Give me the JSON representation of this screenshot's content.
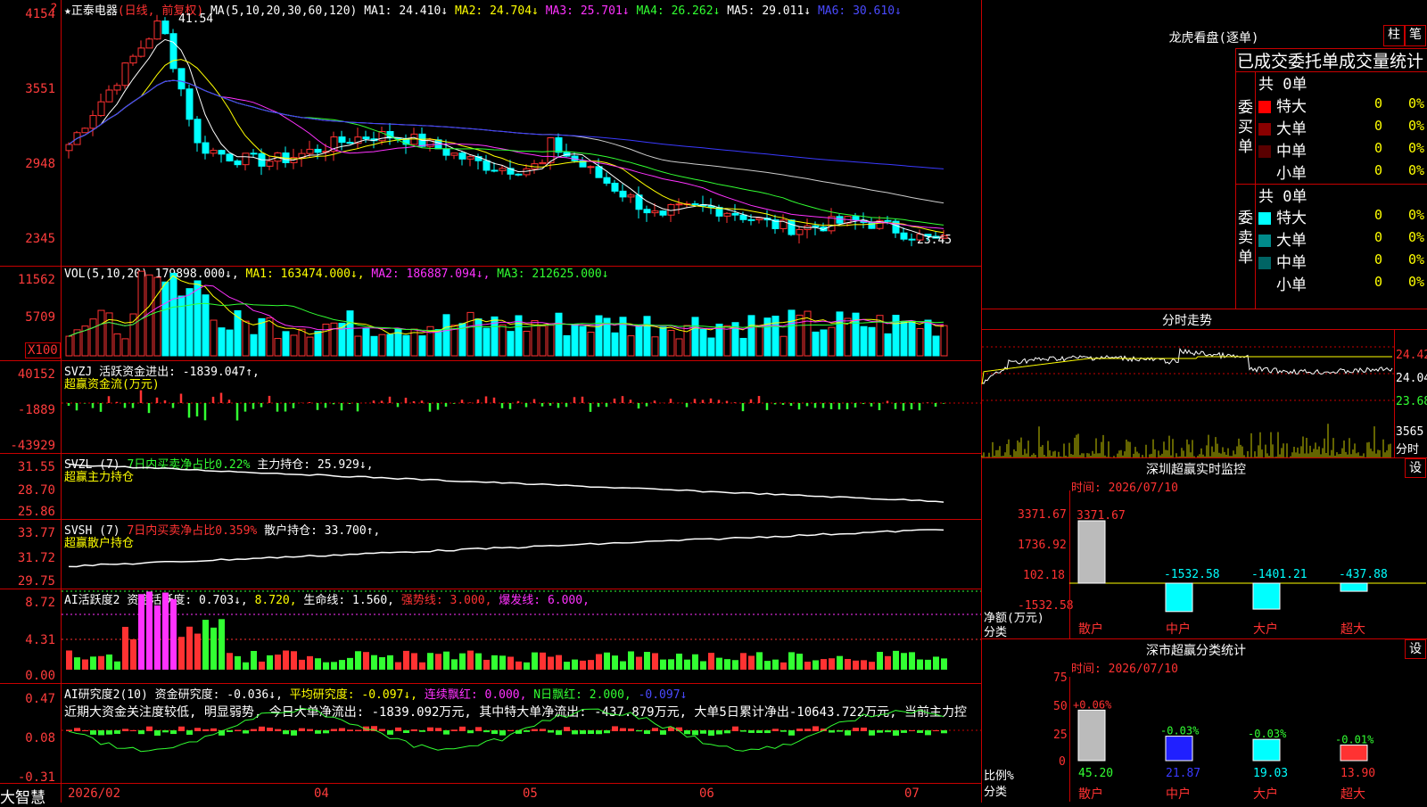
{
  "stock": {
    "name": "正泰电器",
    "period": "(日线, 前复权)",
    "high_label": "41.54",
    "low_label": "23.45"
  },
  "ma_line": {
    "label": "MA(5,10,20,30,60,120)",
    "ma1": "MA1: 24.410↓",
    "ma2": "MA2: 24.704↓",
    "ma3": "MA3: 25.701↓",
    "ma4": "MA4: 26.262↓",
    "ma5": "MA5: 29.011↓",
    "ma6": "MA6: 30.610↓"
  },
  "price_axis": [
    "4154",
    "3551",
    "2948",
    "2345"
  ],
  "vol": {
    "label": "VOL(5,10,20)",
    "value": "179898.000↓,",
    "ma1": "MA1: 163474.000↓,",
    "ma2": "MA2: 186887.094↓,",
    "ma3": "MA3: 212625.000↓",
    "axis": [
      "11562",
      "5709",
      "X100"
    ]
  },
  "svzj": {
    "label": "SVZJ",
    "text": "活跃资金进出: -1839.047↑,",
    "subtitle": "超赢资金流(万元)",
    "axis": [
      "40152",
      "-1889",
      "-43929"
    ]
  },
  "svzl": {
    "label": "SVZL (7)",
    "ratio": "7日内买卖净占比0.22%",
    "main": "主力持仓: 25.929↓,",
    "subtitle": "超赢主力持仓",
    "axis": [
      "31.55",
      "28.70",
      "25.86"
    ]
  },
  "svsh": {
    "label": "SVSH (7)",
    "ratio": "7日内买卖净占比0.359%",
    "retail": "散户持仓: 33.700↑,",
    "subtitle": "超赢散户持仓",
    "axis": [
      "33.77",
      "31.72",
      "29.75"
    ]
  },
  "ai_active": {
    "label": "AI活跃度2",
    "active": "资金活跃度: 0.703↓,",
    "v2": "8.720,",
    "life": "生命线: 1.560,",
    "strong": "强势线: 3.000,",
    "burst": "爆发线: 6.000,",
    "axis": [
      "8.72",
      "4.31",
      "0.00"
    ]
  },
  "ai_research": {
    "label": "AI研究度2(10)",
    "research": "资金研究度: -0.036↓,",
    "avg": "平均研究度: -0.097↓,",
    "cont": "连续飘红: 0.000,",
    "nday": "N日飘红: 2.000,",
    "last": "-0.097↓",
    "axis": [
      "0.47",
      "0.08",
      "-0.31"
    ],
    "comment": "近期大资金关注度较低, 明显弱势, 今日大单净流出: -1839.092万元, 其中特大单净流出: -437.879万元, 大单5日累计净出-10643.722万元, 当前主力控"
  },
  "dates": [
    "2026/02",
    "04",
    "05",
    "06",
    "07"
  ],
  "brand": "大智慧",
  "lhb": {
    "title": "龙虎看盘(逐单)",
    "btn1": "柱",
    "btn2": "笔",
    "header": "已成交委托单成交量统计",
    "buy_label": "委买单",
    "sell_label": "委卖单",
    "buy_total": "共 0单",
    "sell_total": "共 0单",
    "rows": [
      "特大",
      "大单",
      "中单",
      "小单"
    ],
    "zero": "0",
    "pct": "0%"
  },
  "fenshi": {
    "title": "分时走势",
    "axis": [
      "24.42",
      "24.04",
      "23.68",
      "3565",
      "分时"
    ]
  },
  "monitor": {
    "title": "深圳超赢实时监控",
    "settings": "设",
    "time": "时间: 2026/07/10",
    "axis": [
      "3371.67",
      "1736.92",
      "102.18",
      "-1532.58"
    ],
    "unit": "净额(万元)",
    "cat": "分类",
    "bars": [
      {
        "label": "散户",
        "value": "3371.67"
      },
      {
        "label": "中户",
        "value": "-1532.58"
      },
      {
        "label": "大户",
        "value": "-1401.21"
      },
      {
        "label": "超大",
        "value": "-437.88"
      }
    ]
  },
  "classify": {
    "title": "深市超赢分类统计",
    "settings": "设",
    "time": "时间: 2026/07/10",
    "axis": [
      "75",
      "50",
      "25",
      "0"
    ],
    "unit": "比例%",
    "cat": "分类",
    "bars": [
      {
        "label": "散户",
        "value": "45.20",
        "change": "+0.06%"
      },
      {
        "label": "中户",
        "value": "21.87",
        "change": "-0.03%"
      },
      {
        "label": "大户",
        "value": "19.03",
        "change": "-0.03%"
      },
      {
        "label": "超大",
        "value": "13.90",
        "change": "-0.01%"
      }
    ]
  },
  "colors": {
    "up": "#ff3232",
    "down": "#00ffff",
    "grid": "#c80000"
  }
}
